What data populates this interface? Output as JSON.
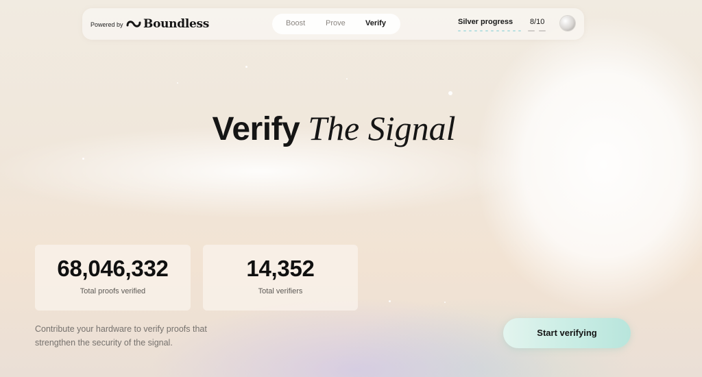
{
  "header": {
    "powered_by": "Powered by",
    "brand": "Boundless",
    "nav": [
      {
        "label": "Boost",
        "active": false
      },
      {
        "label": "Prove",
        "active": false
      },
      {
        "label": "Verify",
        "active": true
      }
    ],
    "progress_title": "Silver progress",
    "progress_count": "8/10"
  },
  "hero": {
    "main": "Verify",
    "accent": "The Signal"
  },
  "stats": [
    {
      "value": "68,046,332",
      "label": "Total proofs verified"
    },
    {
      "value": "14,352",
      "label": "Total verifiers"
    }
  ],
  "description": "Contribute your hardware to verify proofs that strengthen the security of the signal.",
  "cta_label": "Start verifying",
  "colors": {
    "cta_accent": "#b8e5dc",
    "progress_accent": "#b7dfe0",
    "text": "#151515"
  }
}
